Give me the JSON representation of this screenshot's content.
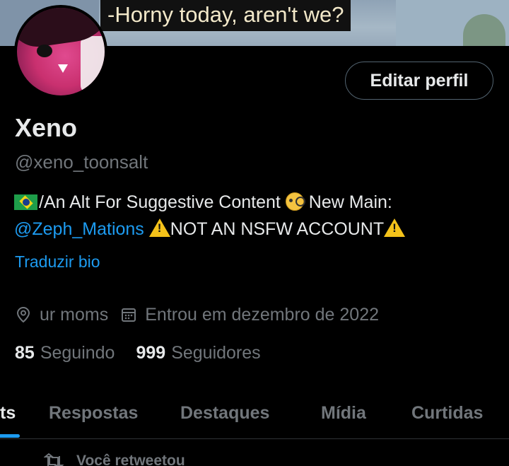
{
  "banner": {
    "caption": "-Horny today, aren't we?"
  },
  "profile": {
    "edit_label": "Editar perfil",
    "name": "Xeno",
    "handle": "@xeno_toonsalt",
    "bio_part1": "/An Alt For Suggestive Content ",
    "bio_part2": " New Main:",
    "bio_mention": "@Zeph_Mations",
    "bio_part3": "NOT AN NSFW ACCOUNT",
    "translate_label": "Traduzir bio",
    "location": "ur moms",
    "joined": "Entrou em dezembro de 2022",
    "following_count": "85",
    "following_label": "Seguindo",
    "followers_count": "999",
    "followers_label": "Seguidores"
  },
  "tabs": [
    {
      "label": "ts",
      "active": true
    },
    {
      "label": "Respostas"
    },
    {
      "label": "Destaques"
    },
    {
      "label": "Mídia"
    },
    {
      "label": "Curtidas"
    }
  ],
  "feed": {
    "retweet_label": "Você retweetou"
  },
  "colors": {
    "accent": "#1d9bf0",
    "muted": "#71767b",
    "text": "#e7e9ea",
    "background": "#000000"
  },
  "icons": [
    "location-icon",
    "calendar-icon",
    "retweet-icon",
    "flag-brazil-icon",
    "monocle-face-icon",
    "warning-icon"
  ]
}
